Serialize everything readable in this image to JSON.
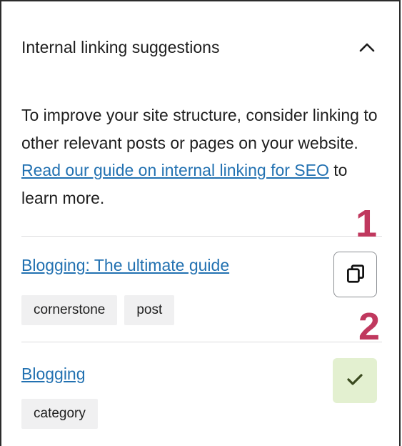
{
  "panel": {
    "title": "Internal linking suggestions",
    "intro_before": "To improve your site structure, consider linking to other relevant posts or pages on your website. ",
    "intro_link": "Read our guide on internal linking for SEO",
    "intro_after": " to learn more."
  },
  "suggestions": [
    {
      "title": "Blogging: The ultimate guide",
      "tags": [
        "cornerstone",
        "post"
      ],
      "action": "copy-icon"
    },
    {
      "title": "Blogging",
      "tags": [
        "category"
      ],
      "action": "checkmark-icon"
    }
  ],
  "annotations": {
    "marker_1": "1",
    "marker_2": "2"
  },
  "colors": {
    "link": "#2271b1",
    "marker": "#c0385e",
    "success_bg": "#e3f0d0",
    "tag_bg": "#f0f0f1"
  }
}
